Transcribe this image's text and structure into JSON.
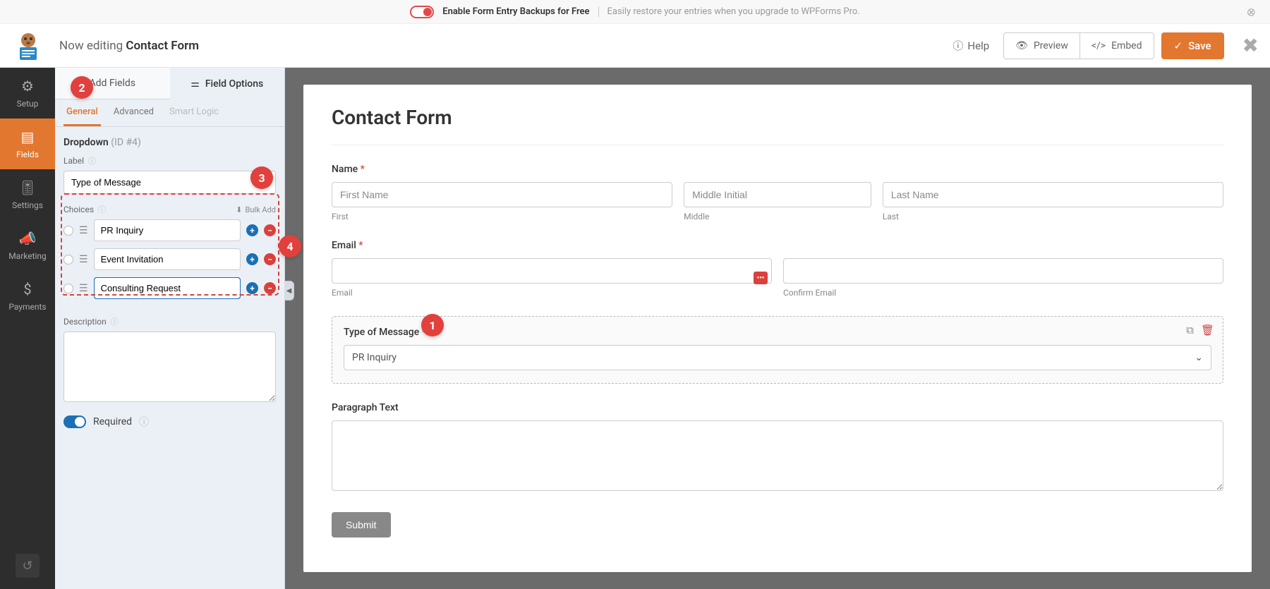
{
  "notice": {
    "title": "Enable Form Entry Backups for Free",
    "subtitle": "Easily restore your entries when you upgrade to WPForms Pro."
  },
  "header": {
    "editing_prefix": "Now editing ",
    "form_name": "Contact Form",
    "help": "Help",
    "preview": "Preview",
    "embed": "Embed",
    "save": "Save"
  },
  "nav": {
    "setup": "Setup",
    "fields": "Fields",
    "settings": "Settings",
    "marketing": "Marketing",
    "payments": "Payments"
  },
  "side": {
    "tab_add": "Add Fields",
    "tab_options": "Field Options",
    "sub_general": "General",
    "sub_advanced": "Advanced",
    "sub_smart": "Smart Logic",
    "field_type": "Dropdown",
    "field_id": "(ID #4)",
    "label_label": "Label",
    "label_value": "Type of Message",
    "choices_label": "Choices",
    "bulk_add": "Bulk Add",
    "choices": [
      "PR Inquiry",
      "Event Invitation",
      "Consulting Request"
    ],
    "description_label": "Description",
    "description_value": "",
    "required_label": "Required"
  },
  "form": {
    "title": "Contact Form",
    "name_label": "Name",
    "first_ph": "First Name",
    "middle_ph": "Middle Initial",
    "last_ph": "Last Name",
    "first_sub": "First",
    "middle_sub": "Middle",
    "last_sub": "Last",
    "email_label": "Email",
    "email_sub": "Email",
    "confirm_sub": "Confirm Email",
    "type_label": "Type of Message",
    "type_value": "PR Inquiry",
    "para_label": "Paragraph Text",
    "submit": "Submit"
  },
  "callouts": {
    "c1": "1",
    "c2": "2",
    "c3": "3",
    "c4": "4"
  }
}
